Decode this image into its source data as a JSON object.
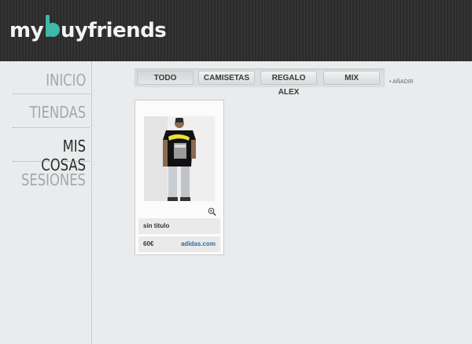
{
  "brand": {
    "logo_pre": "my",
    "logo_post": "uyfriends"
  },
  "nav": {
    "items": [
      "INICIO",
      "TIENDAS",
      "MIS COSAS",
      "SESIONES"
    ],
    "active": "MIS COSAS"
  },
  "tabs": {
    "items": [
      "TODO",
      "CAMISETAS",
      "REGALO ALEX",
      "MIX"
    ],
    "active": "TODO",
    "add_label": "• AÑADIR"
  },
  "item": {
    "title": "sin titulo",
    "price": "60€",
    "store": "adidas.com"
  },
  "colors": {
    "accent": "#3fb9a8",
    "topbar": "#2f2f2f",
    "link": "#2b67a6"
  }
}
